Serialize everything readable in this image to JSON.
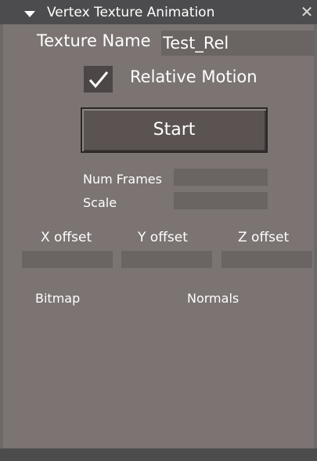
{
  "window": {
    "title": "Vertex Texture Animation",
    "collapse_icon": "triangle-down-icon",
    "close_glyph": "✕",
    "close_icon": "close-icon"
  },
  "texture": {
    "label": "Texture Name",
    "value": "Test_Rel"
  },
  "relative_motion": {
    "label": "Relative Motion",
    "checked": true
  },
  "start_button": {
    "label": "Start"
  },
  "num_frames": {
    "label": "Num Frames",
    "value": ""
  },
  "scale": {
    "label": "Scale",
    "value": ""
  },
  "offsets": {
    "x_label": "X offset",
    "y_label": "Y offset",
    "z_label": "Z offset",
    "x_value": "",
    "y_value": "",
    "z_value": ""
  },
  "options": {
    "bitmap_label": "Bitmap",
    "normals_label": "Normals"
  },
  "colors": {
    "panel": "#7b7472",
    "titlebar": "#4c4b4d",
    "field": "#6a6462",
    "button": "#5b5352"
  }
}
